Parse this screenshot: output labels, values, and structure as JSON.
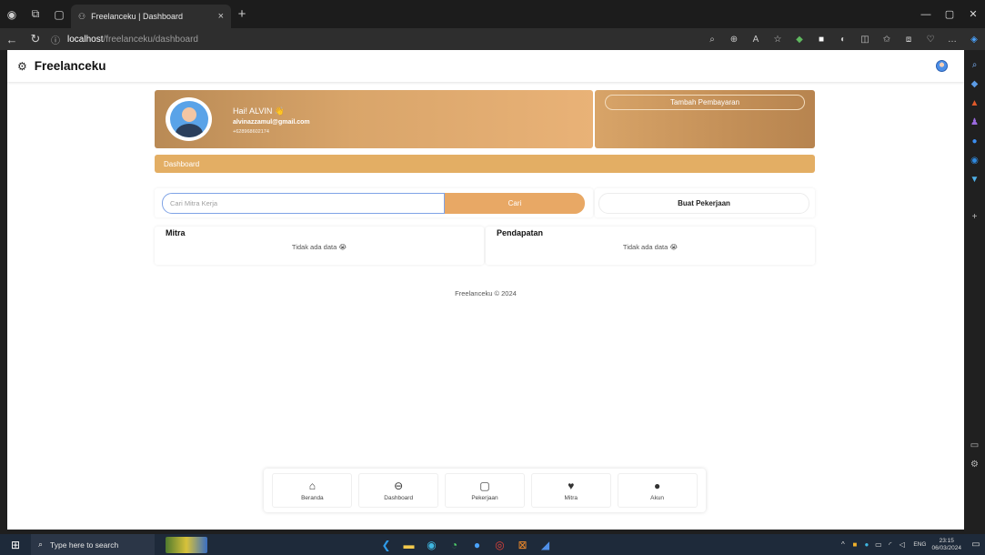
{
  "browser": {
    "tab_title": "Freelanceku | Dashboard",
    "tab_close": "×",
    "new_tab": "+",
    "url_host": "localhost",
    "url_path": "/freelanceku/dashboard"
  },
  "app": {
    "brand": "Freelanceku"
  },
  "profile": {
    "greeting": "Hai! ALVIN 👋",
    "email": "alvinazzamul@gmail.com",
    "phone": "+628968602174"
  },
  "payment": {
    "add_label": "Tambah Pembayaran"
  },
  "dashboard": {
    "label": "Dashboard"
  },
  "search": {
    "placeholder": "Cari Mitra Kerja",
    "button_label": "Cari"
  },
  "job": {
    "button_label": "Buat Pekerjaan"
  },
  "panels": {
    "mitra_title": "Mitra",
    "mitra_empty": "Tidak ada data 😭",
    "pendapatan_title": "Pendapatan",
    "pendapatan_empty": "Tidak ada data 😭"
  },
  "footer": {
    "text": "Freelanceku © 2024"
  },
  "bottom_nav": {
    "beranda": "Beranda",
    "dashboard": "Dashboard",
    "pekerjaan": "Pekerjaan",
    "mitra": "Mitra",
    "akun": "Akun"
  },
  "taskbar": {
    "search_placeholder": "Type here to search",
    "lang": "ENG",
    "time": "23:15",
    "date": "06/03/2024"
  },
  "colors": {
    "accent": "#e8a865",
    "profile_gradient_start": "#b98a55",
    "dash_bar": "#e3ae64"
  }
}
